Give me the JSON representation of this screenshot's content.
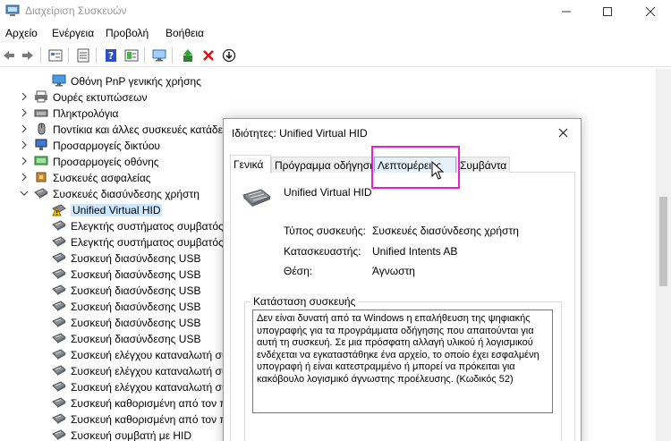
{
  "window": {
    "title": "Διαχείριση Συσκευών"
  },
  "menu": [
    "Αρχείο",
    "Ενέργεια",
    "Προβολή",
    "Βοήθεια"
  ],
  "toolbar": {
    "icons": [
      "back-arrow-icon",
      "forward-arrow-icon",
      "device-view-icon",
      "properties-icon",
      "help-icon",
      "scan-hardware-icon",
      "monitor-icon",
      "update-driver-icon",
      "uninstall-icon",
      "disable-device-icon"
    ]
  },
  "tree": {
    "rows": [
      {
        "label": "Οθόνη PnP γενικής χρήσης",
        "expander": "none",
        "icon": "monitor-icon"
      },
      {
        "label": "Ουρές εκτυπώσεων",
        "expander": "collapsed",
        "icon": "printer-icon"
      },
      {
        "label": "Πληκτρολόγια",
        "expander": "collapsed",
        "icon": "keyboard-icon"
      },
      {
        "label": "Ποντίκια και άλλες συσκευές κατάδειξης",
        "expander": "collapsed",
        "icon": "mouse-icon"
      },
      {
        "label": "Προσαρμογείς δικτύου",
        "expander": "collapsed",
        "icon": "network-icon"
      },
      {
        "label": "Προσαρμογείς οθόνης",
        "expander": "collapsed",
        "icon": "display-adapter-icon"
      },
      {
        "label": "Συσκευές ασφαλείας",
        "expander": "collapsed",
        "icon": "security-icon"
      },
      {
        "label": "Συσκευές διασύνδεσης χρήστη",
        "expander": "expanded",
        "icon": "hid-icon"
      },
      {
        "label": "Unified Virtual HID",
        "expander": "none",
        "icon": "warning-icon",
        "selected": true
      },
      {
        "label": "Ελεγκτής συστήματος συμβατός με HID",
        "expander": "none",
        "icon": "hid-icon"
      },
      {
        "label": "Ελεγκτής συστήματος συμβατός με HID",
        "expander": "none",
        "icon": "hid-icon"
      },
      {
        "label": "Συσκευή διασύνδεσης USB",
        "expander": "none",
        "icon": "hid-icon"
      },
      {
        "label": "Συσκευή διασύνδεσης USB",
        "expander": "none",
        "icon": "hid-icon"
      },
      {
        "label": "Συσκευή διασύνδεσης USB",
        "expander": "none",
        "icon": "hid-icon"
      },
      {
        "label": "Συσκευή διασύνδεσης USB",
        "expander": "none",
        "icon": "hid-icon"
      },
      {
        "label": "Συσκευή διασύνδεσης USB",
        "expander": "none",
        "icon": "hid-icon"
      },
      {
        "label": "Συσκευή διασύνδεσης USB",
        "expander": "none",
        "icon": "hid-icon"
      },
      {
        "label": "Συσκευή ελέγχου καταναλωτή συμβατή με HID",
        "expander": "none",
        "icon": "hid-icon"
      },
      {
        "label": "Συσκευή ελέγχου καταναλωτή συμβατή με HID",
        "expander": "none",
        "icon": "hid-icon"
      },
      {
        "label": "Συσκευή ελέγχου καταναλωτή συμβατή με HID",
        "expander": "none",
        "icon": "hid-icon"
      },
      {
        "label": "Συσκευή καθορισμένη από τον προμηθευτή",
        "expander": "none",
        "icon": "hid-icon"
      },
      {
        "label": "Συσκευή καθορισμένη από τον προμηθευτή",
        "expander": "none",
        "icon": "hid-icon"
      },
      {
        "label": "Συσκευή συμβατή με HID",
        "expander": "none",
        "icon": "hid-icon"
      }
    ]
  },
  "dialog": {
    "title": "Ιδιότητες: Unified Virtual HID",
    "tabs": [
      {
        "label": "Γενικά",
        "state": "active"
      },
      {
        "label": "Πρόγραμμα οδήγησης",
        "state": "normal"
      },
      {
        "label": "Λεπτομέρειες",
        "state": "hover"
      },
      {
        "label": "Συμβάντα",
        "state": "normal"
      }
    ],
    "device_name": "Unified Virtual HID",
    "properties": [
      {
        "label": "Τύπος συσκευής:",
        "value": "Συσκευές διασύνδεσης χρήστη"
      },
      {
        "label": "Κατασκευαστής:",
        "value": "Unified Intents AB"
      },
      {
        "label": "Θέση:",
        "value": "Άγνωστη"
      }
    ],
    "status_caption": "Κατάσταση συσκευής",
    "status_text": "Δεν είναι δυνατή από τα Windows η επαλήθευση της ψηφιακής υπογραφής για τα προγράμματα οδήγησης που απαιτούνται για αυτή τη συσκευή. Σε μια πρόσφατη αλλαγή υλικού ή λογισμικού ενδέχεται να εγκαταστάθηκε ένα αρχείο, το οποίο έχει εσφαλμένη υπογραφή ή είναι κατεστραμμένο ή μπορεί να πρόκειται για κακόβουλο λογισμικό άγνωστης προέλευσης. (Κωδικός 52)"
  },
  "colors": {
    "highlight": "#e81fd0",
    "selection": "#cce8ff",
    "warning": "#f5c400",
    "error_red": "#e01010"
  }
}
